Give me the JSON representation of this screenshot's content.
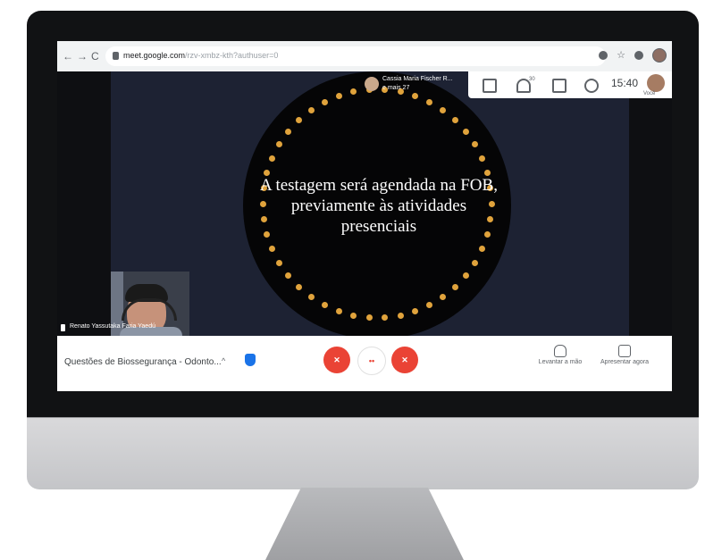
{
  "browser": {
    "back": "←",
    "forward": "→",
    "reload": "C",
    "url_host": "meet.google.com",
    "url_rest": "/rzv-xmbz-kth?authuser=0"
  },
  "slide": {
    "line1": "A testagem será agendada na FOB,",
    "line2": "previamente às atividades",
    "line3": "presenciais"
  },
  "presenter": {
    "name": "Cassia Maria Fischer R...",
    "more": "e mais 27"
  },
  "top_panel": {
    "people_count": "30",
    "time": "15:40",
    "you_label": "Você"
  },
  "participant": {
    "name": "Renato Yassutaka Faria Yaedú"
  },
  "bottom_bar": {
    "meeting_title": "Questões de Biossegurança - Odonto...",
    "chevron": "^",
    "raise_hand": "Levantar a mão",
    "present_now": "Apresentar agora"
  },
  "colors": {
    "accent_red": "#ea4335",
    "dot_gold": "#e0a33c",
    "slide_bg": "#1d2233"
  }
}
